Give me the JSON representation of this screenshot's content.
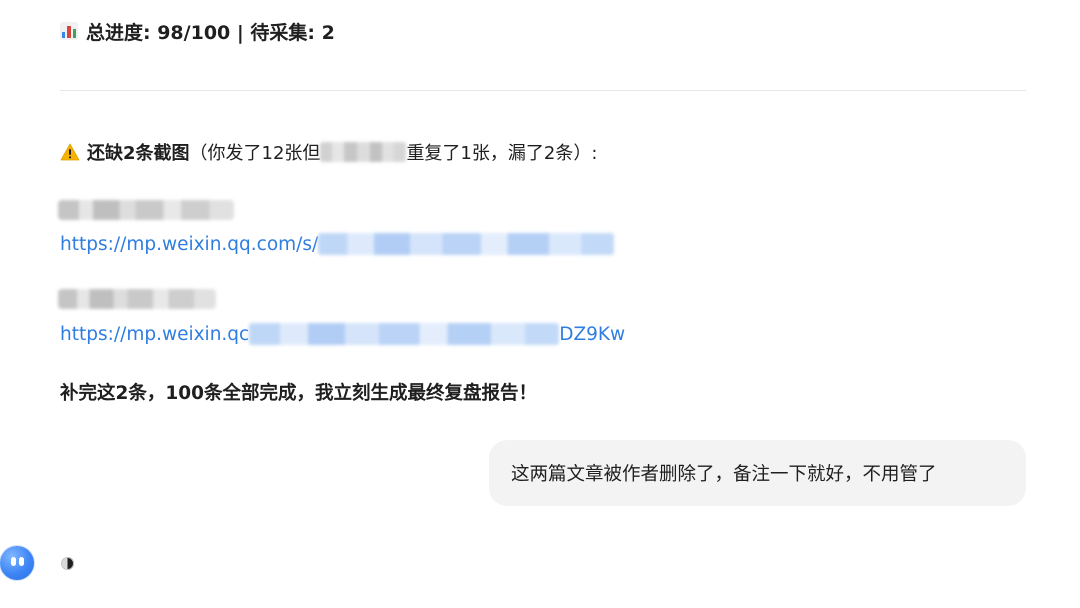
{
  "progress": {
    "icon": "bar-chart-icon",
    "text": "总进度: 98/100 | 待采集: 2"
  },
  "warning": {
    "icon": "warning-icon",
    "bold_text": "还缺2条截图",
    "text_before_redaction": "（你发了12张但",
    "text_after_redaction": "重复了1张，漏了2条）:"
  },
  "missing_items": [
    {
      "title_redacted": true,
      "link_prefix": "https://mp.weixin.qq.com/s/",
      "link_suffix": ""
    },
    {
      "title_redacted": true,
      "link_prefix": "https://mp.weixin.qc",
      "link_suffix": "DZ9Kw"
    }
  ],
  "summary": {
    "text": "补完这2条，100条全部完成，我立刻生成最终复盘报告！"
  },
  "user_message": {
    "text": "这两篇文章被作者删除了，备注一下就好，不用管了"
  },
  "assistant": {
    "avatar_icon": "assistant-avatar-icon",
    "status_icon": "loading-indicator-icon"
  },
  "colors": {
    "link": "#2f7de1",
    "bubble_bg": "#f3f3f3",
    "divider": "#e6e6e6",
    "avatar": "#3d85f5"
  }
}
